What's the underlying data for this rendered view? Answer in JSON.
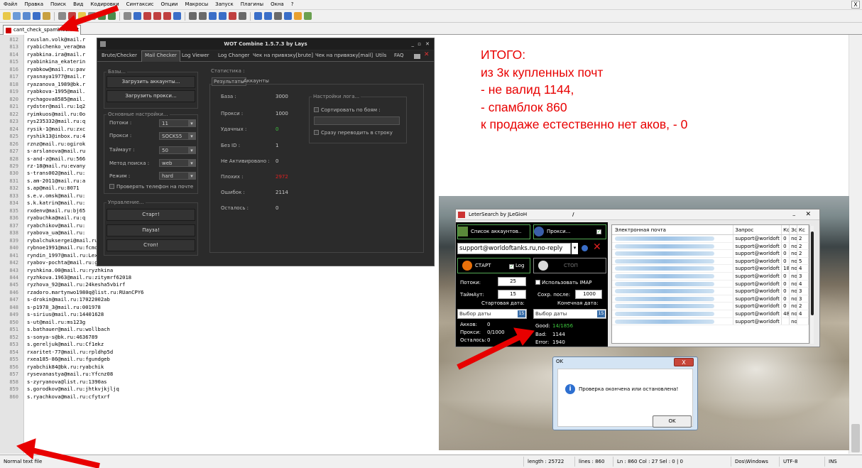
{
  "menu": [
    "Файл",
    "Правка",
    "Поиск",
    "Вид",
    "Кодировки",
    "Синтаксис",
    "Опции",
    "Макросы",
    "Запуск",
    "Плагины",
    "Окна",
    "?"
  ],
  "menu_close": "X",
  "tab": {
    "label": "cant_check_spamblock.txt"
  },
  "editor": {
    "line_numbers": [
      "812",
      "813",
      "814",
      "815",
      "816",
      "817",
      "818",
      "819",
      "820",
      "821",
      "822",
      "823",
      "824",
      "825",
      "826",
      "827",
      "828",
      "829",
      "830",
      "831",
      "832",
      "833",
      "834",
      "835",
      "836",
      "837",
      "838",
      "839",
      "840",
      "841",
      "842",
      "843",
      "844",
      "845",
      "846",
      "847",
      "848",
      "849",
      "850",
      "851",
      "852",
      "853",
      "854",
      "855",
      "856",
      "857",
      "858",
      "859",
      "860"
    ],
    "lines": [
      "rxuslan.volk@mail.r",
      "ryabichenko_vera@ma",
      "ryabkina.ira@mail.r",
      "ryabinkina_ekaterin",
      "ryabkow@mail.ru:pav",
      "ryasnaya1977@mail.r",
      "ryazanova_1989@bk.r",
      "ryabkova-1995@mail.",
      "rychagova8585@mail.",
      "rydster@mail.ru:1q2",
      "ryimkuos@mail.ru:0o",
      "rys235332@mail.ru:q",
      "rysik-1@mail.ru:zxc",
      "ryshik13@inbox.ru:4",
      "rznz@mail.ru:ogirok",
      "s-arslanova@mail.ru",
      "s-and-z@mail.ru:566",
      "rz-18@mail.ru:evany",
      "s-trans002@mail.ru:",
      "s.am-2011@mail.ru:a",
      "s.ap@mail.ru:8071",
      "s.e.v.omsk@mail.ru:",
      "s.k.katrin@mail.ru:",
      "rxdenv@mail.ru:bj65",
      "ryabuchka@mail.ru:q",
      "ryabchikov@mail.ru:",
      "ryabova_ua@mail.ru:",
      "rybalchuksergei@mail.ru:100anzilop",
      "rybnoe1991@mail.ru:fcmoscow",
      "ryndin_1997@mail.ru:Lexa12",
      "ryabov-pochta@mail.ru:grafanryab",
      "ryshkina.00@mail.ru:ryzhkina",
      "ryzhkova.1963@mail.ru:zitymrf62018",
      "ryzhova_92@mail.ru:24kesha5vbirf",
      "rzadoro.martynwo1980q@list.ru:RUanCPY6",
      "s-drokin@mail.ru:17022002ab",
      "s-p1978_3@mail.ru:001978",
      "s-sirius@mail.ru:14401628",
      "s-ut@mail.ru:ms123g",
      "s.bathauer@mail.ru:wollbach",
      "s-sonya-s@bk.ru:4636789",
      "s.gereljuk@mail.ru:Cf1ekz",
      "rxaritet-77@mail.ru:rpldhp5d",
      "rxea185-86@mail.ru:fgundgeb",
      "ryabchik84@bk.ru:ryabchik",
      "rysevanastya@mail.ru:Yfcnz08",
      "s-zyryanova@list.ru:1390as",
      "s.gorodkov@mail.ru:jhtkvjkjljq",
      "s.ryachkova@mail.ru:cfytxrf"
    ]
  },
  "status": {
    "lang": "Normal text file",
    "length": "length : 25722",
    "lines": "lines : 860",
    "pos": "Ln : 860    Col : 27    Sel : 0 | 0",
    "eol": "Dos\\Windows",
    "enc": "UTF-8",
    "ins": "INS"
  },
  "wot": {
    "title": "WOT Combine 1.5.7.3 by Lays",
    "tabs": [
      "Brute/Checker",
      "Mail Checker",
      "Log Viewer",
      "Log Changer",
      "Чек на привязку[brute]",
      "Чек на привязку[mail]",
      "Utils",
      "FAQ"
    ],
    "bases_label": "Базы...",
    "load_accounts": "Загрузить аккаунты...",
    "load_proxy": "Загрузить прокси...",
    "main_settings": "Основные настройки...",
    "threads_label": "Потоки :",
    "threads_val": "11",
    "proxy_label": "Прокси :",
    "proxy_val": "SOCKS5",
    "timeout_label": "Таймаут :",
    "timeout_val": "50",
    "method_label": "Метод поиска :",
    "method_val": "web",
    "mode_label": "Режим :",
    "mode_val": "hard",
    "check_phone": "Проверять телефон на почте",
    "control_label": "Управление...",
    "start": "Старт!",
    "pause": "Пауза!",
    "stop": "Стоп!",
    "stats_label": "Статистика :",
    "stat_tabs": [
      "Результаты",
      "Аккаунты"
    ],
    "stats": [
      [
        "База :",
        "3000"
      ],
      [
        "Прокси :",
        "1000"
      ],
      [
        "Удачных :",
        "0"
      ],
      [
        "Без ID :",
        "1"
      ],
      [
        "Не Активировано :",
        "0"
      ],
      [
        "Плохих :",
        "2972"
      ],
      [
        "Ошибок :",
        "2114"
      ],
      [
        "Осталось :",
        "0"
      ]
    ],
    "log_settings": "Настройки лога...",
    "sort_by_battles": "Сортировать по боям :",
    "to_line": "Сразу переводить в строку"
  },
  "annotation": [
    "ИТОГО:",
    "из 3к купленных почт",
    "- не валид 1144,",
    "- спамблок 860",
    "к продаже естественно нет аков, - 0"
  ],
  "leter": {
    "title": "LeterSearch by JLeGioH",
    "slash": "/",
    "accounts_btn": "Список аккаунтов..",
    "proxy_btn": "Прокси...",
    "sender": "support@worldoftanks.ru,no-reply",
    "start_btn": "СТАРТ",
    "log_label": "Log",
    "stop_btn": "СТОП",
    "threads_label": "Потоки:",
    "threads_val": "25",
    "timeout_label": "ТаймАут:",
    "timeout_val": "15",
    "imap_label": "Использовать IMAP",
    "save_after_label": "Сохр. после:",
    "save_after_val": "1000",
    "start_date_label": "Стартовая дата:",
    "end_date_label": "Конечная дата:",
    "date_placeholder": "Выбор даты",
    "date_day": "15",
    "accs_label": "Акков:",
    "accs_val": "0",
    "proxy_cnt_label": "Прокси:",
    "proxy_cnt_val": "0/1000",
    "left_label": "Осталось:",
    "left_val": "0",
    "good_label": "Good:",
    "good_val": "14/1856",
    "bad_label": "Bad:",
    "bad_val": "1144",
    "error_label": "Error:",
    "error_val": "1940",
    "table_headers": [
      "Электронная почта",
      "Запрос",
      "Кс",
      "Зс",
      "Кс"
    ],
    "table_rows": [
      [
        "support@worldoft",
        "0",
        "no",
        "2"
      ],
      [
        "support@worldoft",
        "0",
        "no",
        "2"
      ],
      [
        "support@worldoft",
        "0",
        "no",
        "2"
      ],
      [
        "support@worldoft",
        "0",
        "no",
        "5"
      ],
      [
        "support@worldoft",
        "18",
        "no",
        "4"
      ],
      [
        "support@worldoft",
        "0",
        "no",
        "3"
      ],
      [
        "support@worldoft",
        "0",
        "no",
        "4"
      ],
      [
        "support@worldoft",
        "0",
        "no",
        "3"
      ],
      [
        "support@worldoft",
        "0",
        "no",
        "3"
      ],
      [
        "support@worldoft",
        "0",
        "no",
        "2"
      ],
      [
        "support@worldoft",
        "48",
        "no",
        "4"
      ],
      [
        "support@worldoft",
        "",
        "no",
        ""
      ]
    ]
  },
  "dialog": {
    "title": "OK",
    "close": "X",
    "message": "Проверка окончена или остановлена!",
    "ok": "OK"
  },
  "colors": {
    "accent_red": "#e80000",
    "good_green": "#3ec83e",
    "bad_red": "#e02020"
  }
}
